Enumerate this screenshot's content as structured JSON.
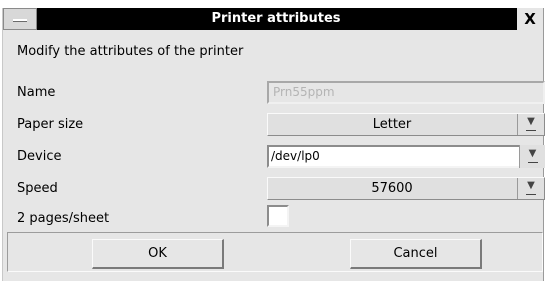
{
  "window": {
    "title": "Printer attributes",
    "close_glyph": "X",
    "heading": "Modify the attributes of the printer"
  },
  "fields": {
    "name": {
      "label": "Name",
      "value": "Prn55ppm",
      "enabled": false
    },
    "paper_size": {
      "label": "Paper size",
      "value": "Letter"
    },
    "device": {
      "label": "Device",
      "value": "/dev/lp0"
    },
    "speed": {
      "label": "Speed",
      "value": "57600"
    },
    "pages_per_sheet": {
      "label": "2 pages/sheet",
      "checked": false
    }
  },
  "buttons": {
    "ok": "OK",
    "cancel": "Cancel"
  },
  "icons": {
    "dropdown": "chevron-down-icon",
    "menu": "window-menu-icon",
    "close": "close-icon"
  },
  "colors": {
    "titlebar": "#000000",
    "window_bg": "#e6e6e6",
    "title_text": "#ffffff"
  }
}
